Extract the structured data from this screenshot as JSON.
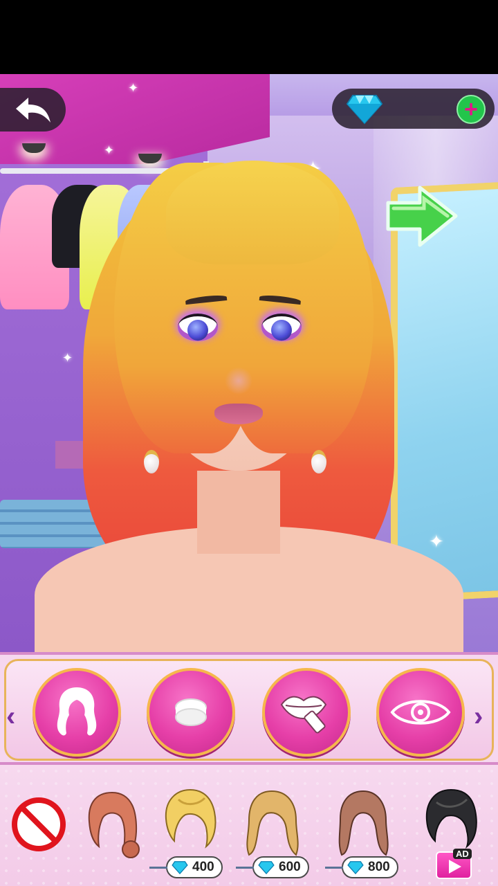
{
  "app": {
    "title": ""
  },
  "top_bar": {
    "back_icon": "back-arrow-icon",
    "gems": {
      "icon": "diamond-icon",
      "count": "",
      "add_icon": "plus-icon",
      "add_symbol": "+"
    },
    "next_icon": "next-arrow-icon"
  },
  "categories": {
    "prev_symbol": "‹",
    "next_symbol": "›",
    "items": [
      {
        "name": "hair",
        "icon": "hair-icon"
      },
      {
        "name": "foundation",
        "icon": "compact-powder-icon"
      },
      {
        "name": "lipstick",
        "icon": "lipstick-icon"
      },
      {
        "name": "eye-makeup",
        "icon": "eye-icon"
      }
    ]
  },
  "hair_items": [
    {
      "icon": "none-icon",
      "price": null,
      "locked": false
    },
    {
      "icon": "hairstyle-bun-brown-icon",
      "price": null,
      "locked": false
    },
    {
      "icon": "hairstyle-updo-blonde-icon",
      "price": "400",
      "locked": true
    },
    {
      "icon": "hairstyle-wavy-blonde-icon",
      "price": "600",
      "locked": true
    },
    {
      "icon": "hairstyle-wavy-brown-icon",
      "price": "800",
      "locked": true
    },
    {
      "icon": "hairstyle-updo-black-icon",
      "price": null,
      "locked": true,
      "unlock_via": "ad"
    }
  ],
  "ad_badge": {
    "label": "AD",
    "icon": "video-play-icon"
  },
  "colors": {
    "accent_pink": "#e63fa8",
    "gold_border": "#f6b74c",
    "plus_green": "#22c54b",
    "arrow_purple": "#7a2fa0"
  }
}
